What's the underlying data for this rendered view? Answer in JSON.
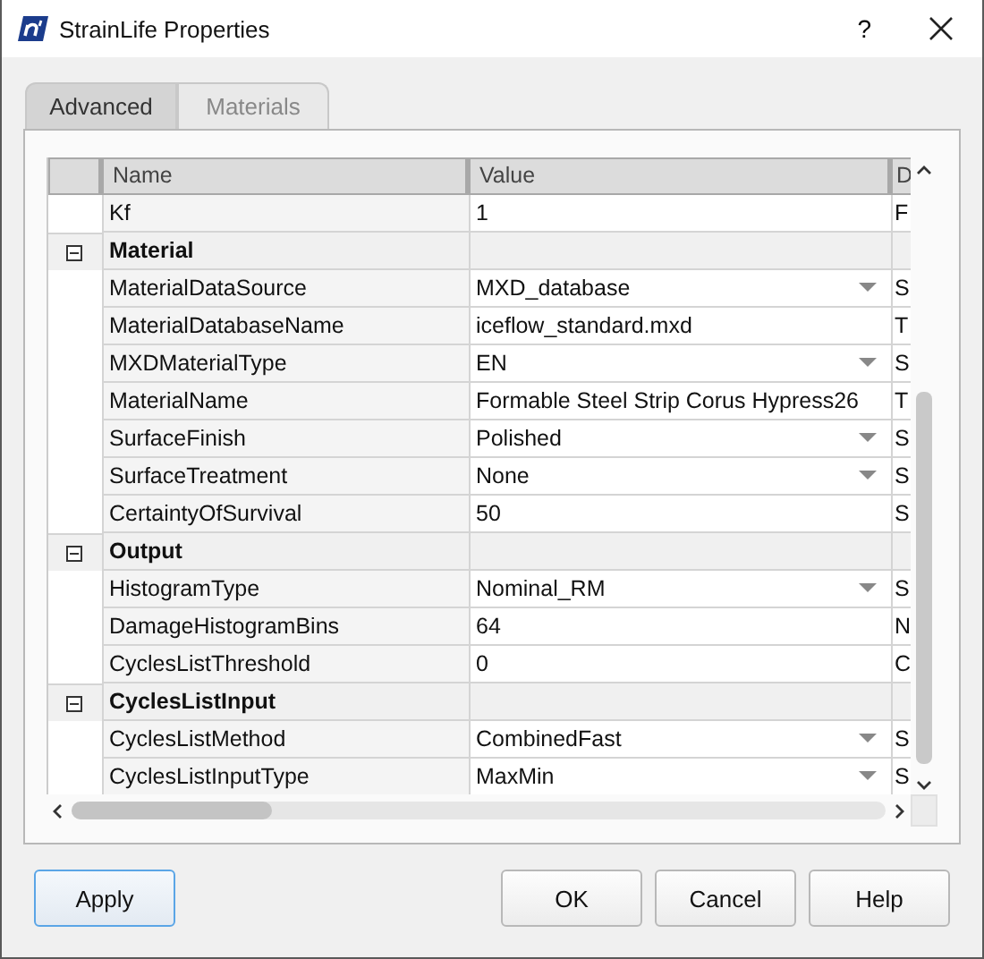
{
  "window": {
    "title": "StrainLife Properties",
    "help": "?"
  },
  "tabs": [
    {
      "label": "Advanced",
      "selected": true
    },
    {
      "label": "Materials",
      "selected": false
    }
  ],
  "grid": {
    "columns": [
      "Name",
      "Value",
      "D"
    ],
    "rows": [
      {
        "kind": "property",
        "name": "Kf",
        "value": "1",
        "dropdown": false,
        "description": "F"
      },
      {
        "kind": "category",
        "name": "Material",
        "expanded": true
      },
      {
        "kind": "property",
        "name": "MaterialDataSource",
        "value": "MXD_database",
        "dropdown": true,
        "description": "S"
      },
      {
        "kind": "property",
        "name": "MaterialDatabaseName",
        "value": "iceflow_standard.mxd",
        "dropdown": false,
        "description": "T"
      },
      {
        "kind": "property",
        "name": "MXDMaterialType",
        "value": "EN",
        "dropdown": true,
        "description": "S"
      },
      {
        "kind": "property",
        "name": "MaterialName",
        "value": "Formable Steel Strip Corus Hypress26",
        "dropdown": false,
        "description": "T"
      },
      {
        "kind": "property",
        "name": "SurfaceFinish",
        "value": "Polished",
        "dropdown": true,
        "description": "S"
      },
      {
        "kind": "property",
        "name": "SurfaceTreatment",
        "value": "None",
        "dropdown": true,
        "description": "S"
      },
      {
        "kind": "property",
        "name": "CertaintyOfSurvival",
        "value": "50",
        "dropdown": false,
        "description": "S"
      },
      {
        "kind": "category",
        "name": "Output",
        "expanded": true
      },
      {
        "kind": "property",
        "name": "HistogramType",
        "value": "Nominal_RM",
        "dropdown": true,
        "description": "S"
      },
      {
        "kind": "property",
        "name": "DamageHistogramBins",
        "value": "64",
        "dropdown": false,
        "description": "N"
      },
      {
        "kind": "property",
        "name": "CyclesListThreshold",
        "value": "0",
        "dropdown": false,
        "description": "C"
      },
      {
        "kind": "category",
        "name": "CyclesListInput",
        "expanded": true
      },
      {
        "kind": "property",
        "name": "CyclesListMethod",
        "value": "CombinedFast",
        "dropdown": true,
        "description": "S"
      },
      {
        "kind": "property",
        "name": "CyclesListInputType",
        "value": "MaxMin",
        "dropdown": true,
        "description": "S"
      }
    ]
  },
  "buttons": [
    {
      "label": "Apply",
      "focused": true
    },
    {
      "label": "OK",
      "focused": false
    },
    {
      "label": "Cancel",
      "focused": false
    },
    {
      "label": "Help",
      "focused": false
    }
  ]
}
